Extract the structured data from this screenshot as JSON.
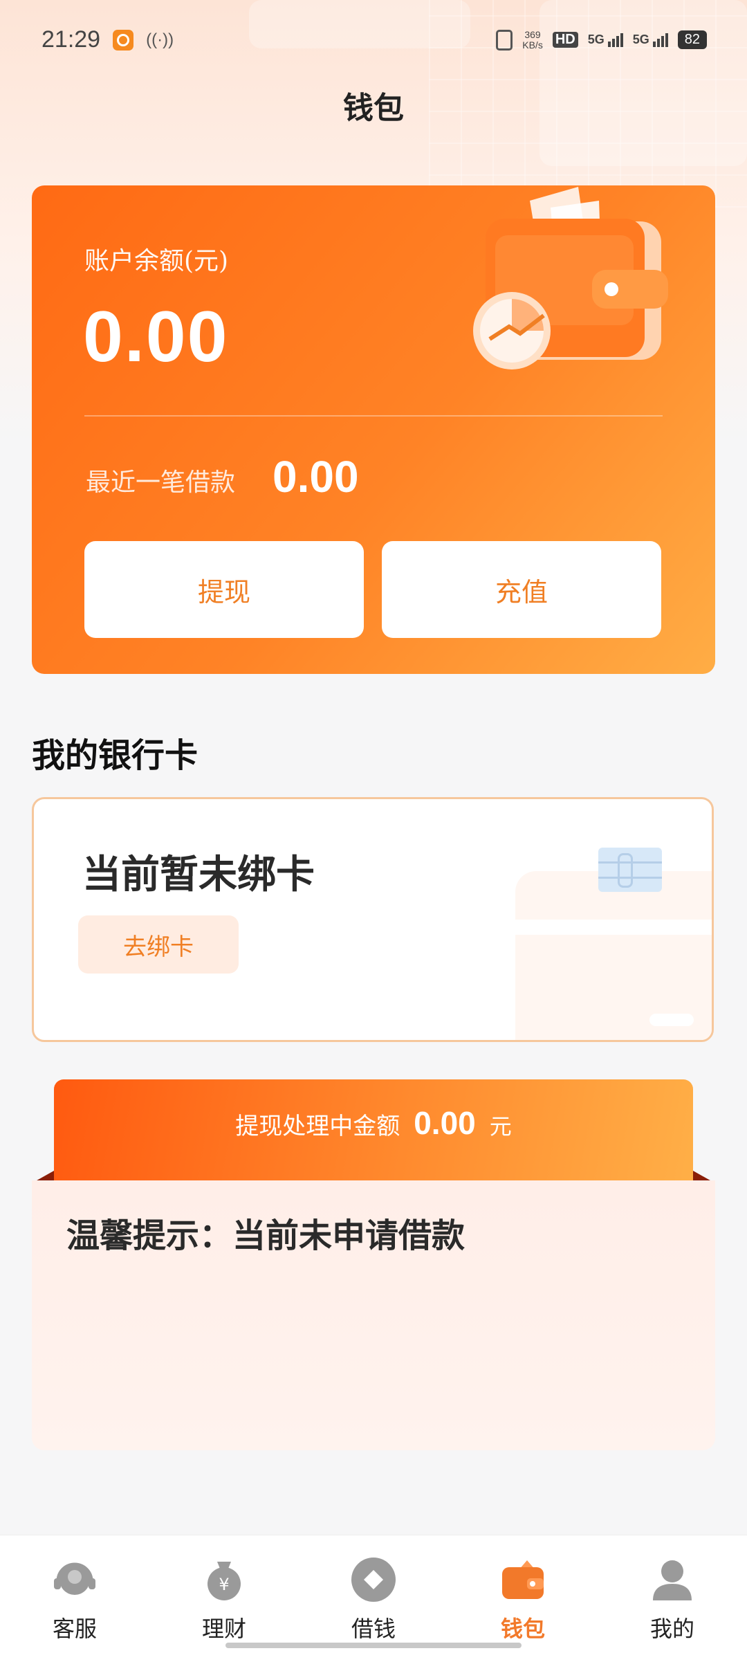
{
  "status_bar": {
    "time": "21:29",
    "network_speed_value": "369",
    "network_speed_unit": "KB/s",
    "hd_label": "HD",
    "signal_1": "5G",
    "signal_2": "5G",
    "battery": "82"
  },
  "header": {
    "title": "钱包"
  },
  "wallet": {
    "balance_label": "账户余额(元)",
    "balance_value": "0.00",
    "recent_loan_label": "最近一笔借款",
    "recent_loan_value": "0.00",
    "withdraw_label": "提现",
    "recharge_label": "充值"
  },
  "bank_section": {
    "title": "我的银行卡",
    "no_card_text": "当前暂未绑卡",
    "bind_button": "去绑卡"
  },
  "pending": {
    "label": "提现处理中金额",
    "amount": "0.00",
    "unit": "元"
  },
  "tip": {
    "text": "温馨提示：当前未申请借款"
  },
  "tabbar": {
    "items": [
      {
        "label": "客服",
        "icon": "customer-service-icon",
        "active": false
      },
      {
        "label": "理财",
        "icon": "money-bag-icon",
        "active": false
      },
      {
        "label": "借钱",
        "icon": "borrow-diamond-icon",
        "active": false
      },
      {
        "label": "钱包",
        "icon": "wallet-icon",
        "active": true
      },
      {
        "label": "我的",
        "icon": "user-icon",
        "active": false
      }
    ],
    "accent_color": "#f2792a",
    "inactive_icon_color": "#9a9a9a"
  },
  "colors": {
    "card_gradient_start": "#ff6a14",
    "card_gradient_end": "#ffad45",
    "button_text": "#f07f24"
  }
}
